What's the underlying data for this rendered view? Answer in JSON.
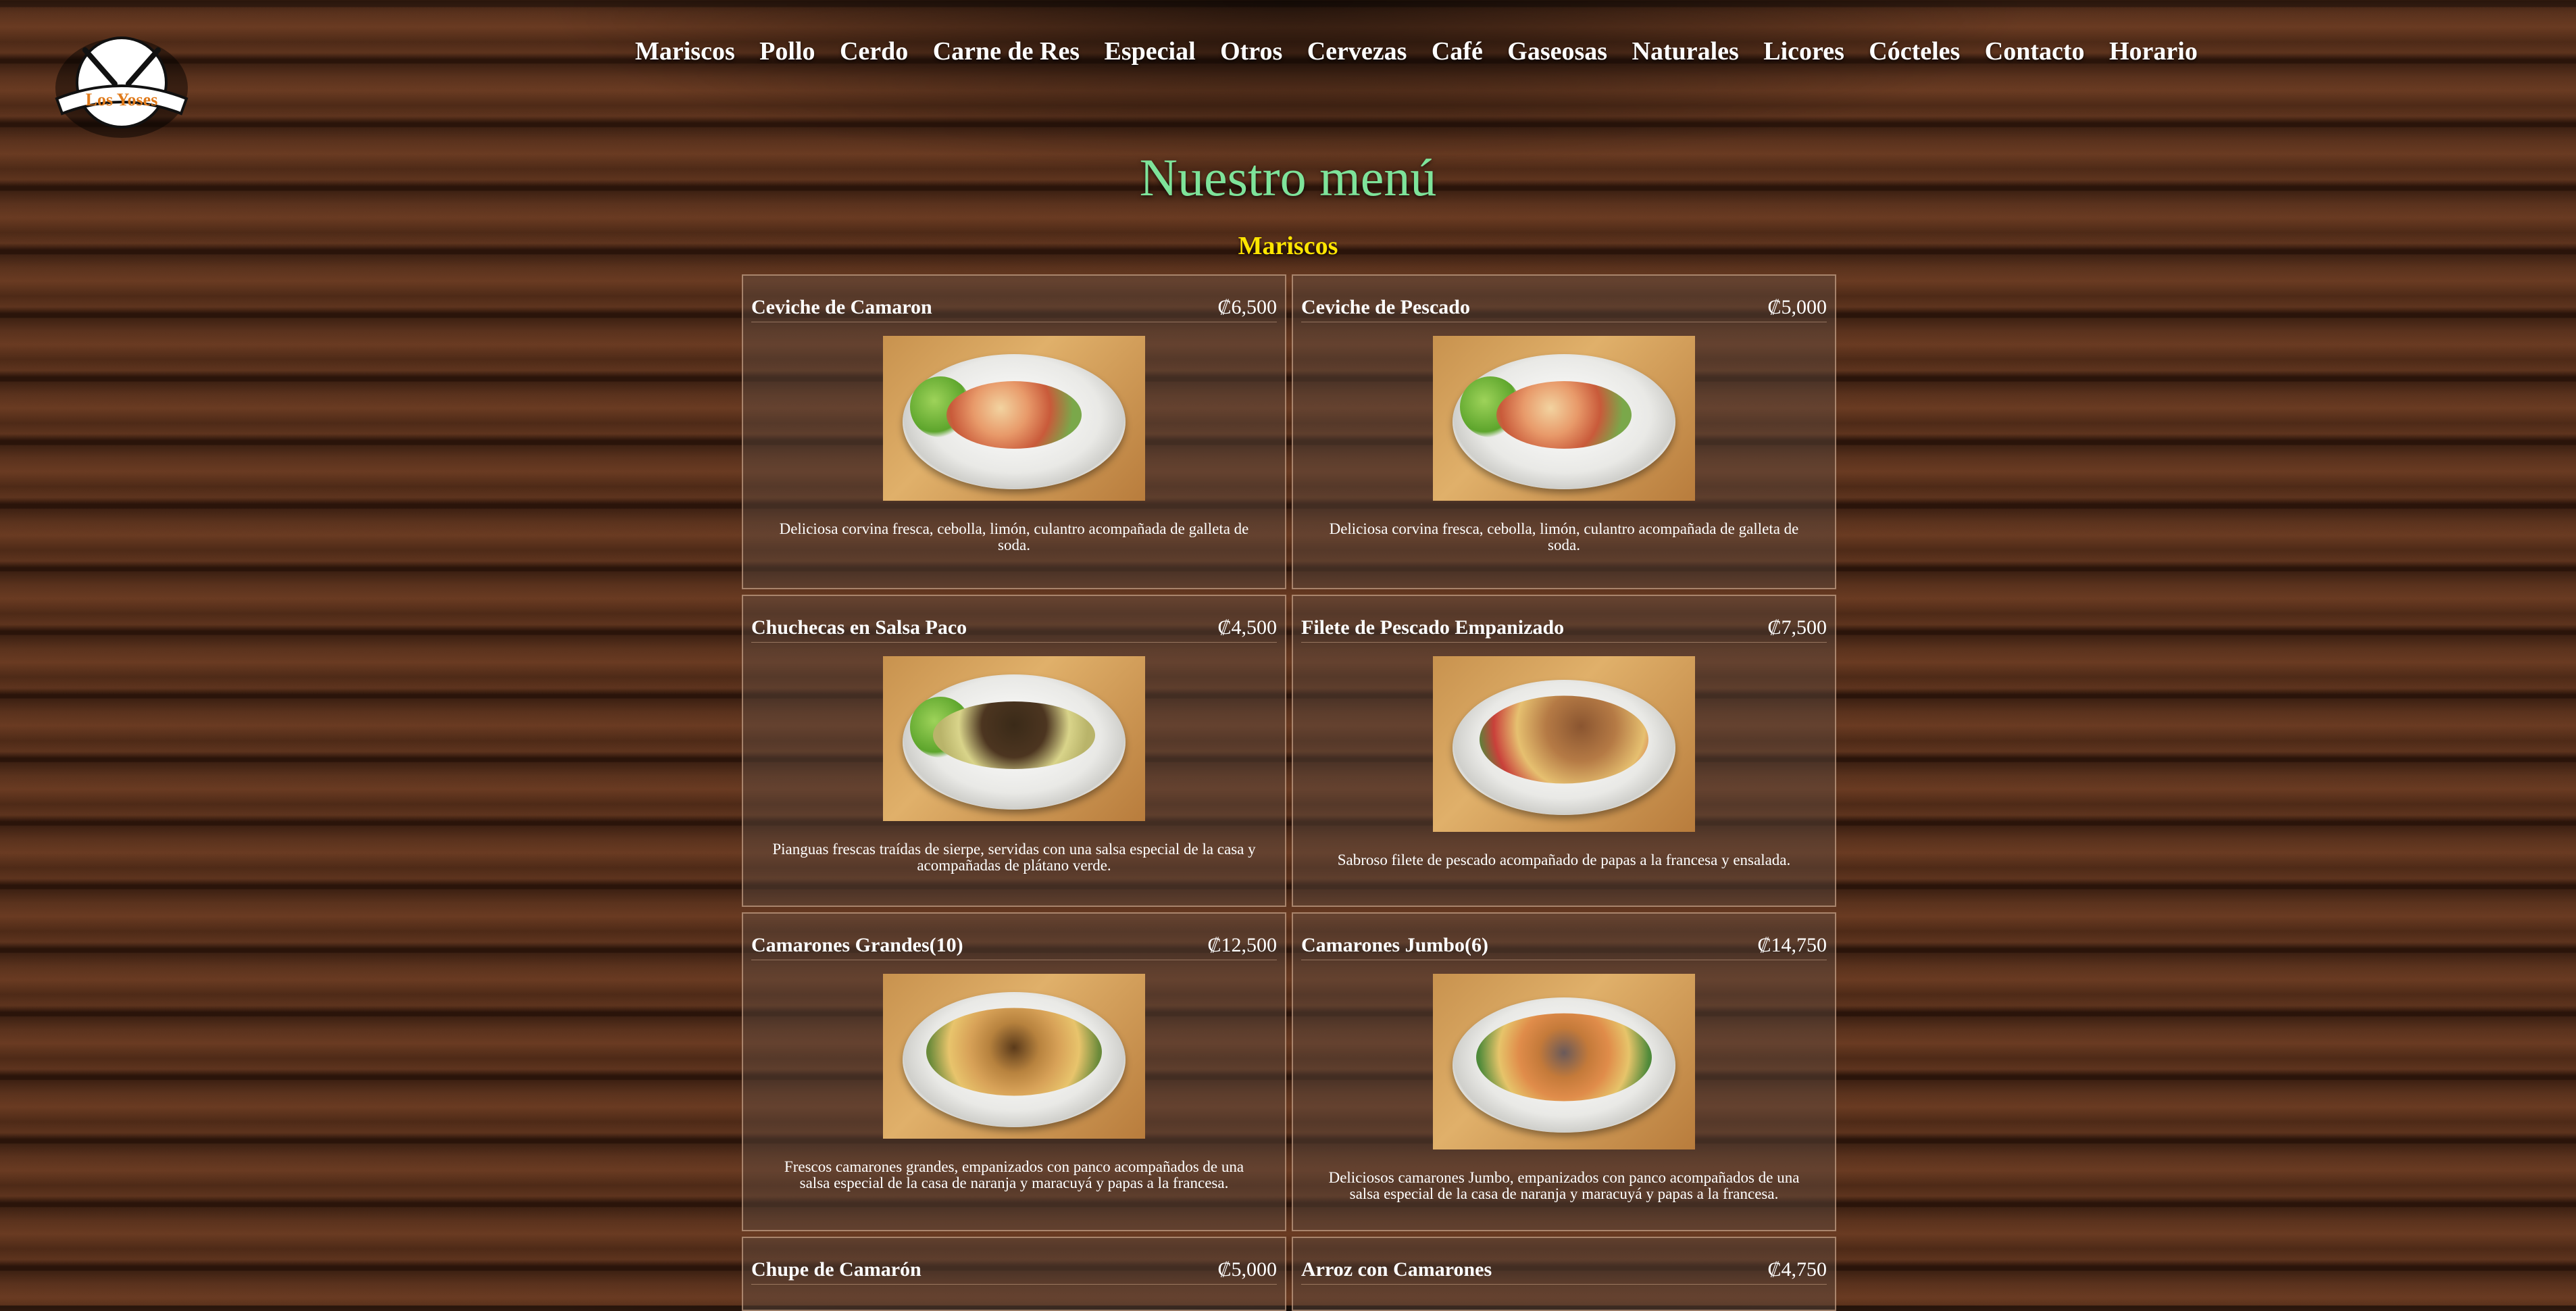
{
  "brand": {
    "logo_text": "Los Yoses"
  },
  "nav": {
    "items": [
      "Mariscos",
      "Pollo",
      "Cerdo",
      "Carne de Res",
      "Especial",
      "Otros",
      "Cervezas",
      "Café",
      "Gaseosas",
      "Naturales",
      "Licores",
      "Cócteles",
      "Contacto",
      "Horario"
    ]
  },
  "page": {
    "title": "Nuestro menú",
    "section": "Mariscos"
  },
  "items": [
    {
      "name": "Ceviche de Camaron",
      "price": "₡6,500",
      "desc": "Deliciosa corvina fresca, cebolla, limón, culantro acompañada de galleta de soda.",
      "img": "ceviche"
    },
    {
      "name": "Ceviche de Pescado",
      "price": "₡5,000",
      "desc": "Deliciosa corvina fresca, cebolla, limón, culantro acompañada de galleta de soda.",
      "img": "ceviche"
    },
    {
      "name": "Chuchecas en Salsa Paco",
      "price": "₡4,500",
      "desc": "Pianguas frescas traídas de sierpe, servidas con una salsa especial de la casa y acompañadas de plátano verde.",
      "img": "chuchecas"
    },
    {
      "name": "Filete de Pescado Empanizado",
      "price": "₡7,500",
      "desc": "Sabroso filete de pescado acompañado de papas a la francesa y ensalada.",
      "img": "filete"
    },
    {
      "name": "Camarones Grandes(10)",
      "price": "₡12,500",
      "desc": "Frescos camarones grandes, empanizados con panco acompañados de una salsa especial de la casa de naranja y maracuyá y papas a la francesa.",
      "img": "camarones"
    },
    {
      "name": "Camarones Jumbo(6)",
      "price": "₡14,750",
      "desc": "Deliciosos camarones Jumbo, empanizados con panco acompañados de una salsa especial de la casa de naranja y maracuyá y papas a la francesa.",
      "img": "jumbo"
    },
    {
      "name": "Chupe de Camarón",
      "price": "₡5,000"
    },
    {
      "name": "Arroz con Camarones",
      "price": "₡4,750"
    }
  ]
}
